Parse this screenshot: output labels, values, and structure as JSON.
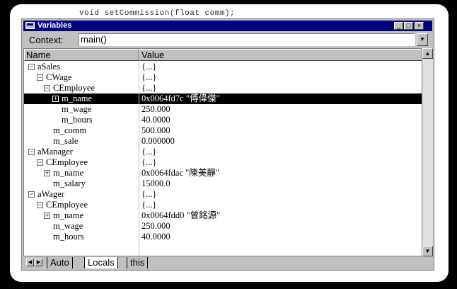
{
  "background_code": "void setCommission(float comm);",
  "window": {
    "title": "Variables"
  },
  "context": {
    "label": "Context:",
    "value": "main()"
  },
  "columns": {
    "name": "Name",
    "value": "Value"
  },
  "rows": [
    {
      "name": "aSales",
      "value": "{...}",
      "toggle": "−",
      "depth": 0
    },
    {
      "name": "CWage",
      "value": "{...}",
      "toggle": "−",
      "depth": 1
    },
    {
      "name": "CEmployee",
      "value": "{...}",
      "toggle": "−",
      "depth": 2
    },
    {
      "name": "m_name",
      "value": "0x0064fd7c \"傅偉傑\"",
      "toggle": "+",
      "depth": 3,
      "selected": true
    },
    {
      "name": "m_wage",
      "value": "250.000",
      "toggle": "",
      "depth": 3
    },
    {
      "name": "m_hours",
      "value": "40.0000",
      "toggle": "",
      "depth": 3
    },
    {
      "name": "m_comm",
      "value": "500.000",
      "toggle": "",
      "depth": 2
    },
    {
      "name": "m_sale",
      "value": "0.000000",
      "toggle": "",
      "depth": 2
    },
    {
      "name": "aManager",
      "value": "{...}",
      "toggle": "−",
      "depth": 0
    },
    {
      "name": "CEmployee",
      "value": "{...}",
      "toggle": "−",
      "depth": 1
    },
    {
      "name": "m_name",
      "value": "0x0064fdac \"陳美靜\"",
      "toggle": "+",
      "depth": 2
    },
    {
      "name": "m_salary",
      "value": "15000.0",
      "toggle": "",
      "depth": 2
    },
    {
      "name": "aWager",
      "value": "{...}",
      "toggle": "−",
      "depth": 0
    },
    {
      "name": "CEmployee",
      "value": "{...}",
      "toggle": "−",
      "depth": 1
    },
    {
      "name": "m_name",
      "value": "0x0064fdd0 \"曾銘源\"",
      "toggle": "+",
      "depth": 2
    },
    {
      "name": "m_wage",
      "value": "250.000",
      "toggle": "",
      "depth": 2
    },
    {
      "name": "m_hours",
      "value": "40.0000",
      "toggle": "",
      "depth": 2
    }
  ],
  "tabs": [
    {
      "label": "Auto"
    },
    {
      "label": "Locals",
      "active": true
    },
    {
      "label": "this"
    }
  ],
  "icons": {
    "window": "window-icon",
    "minimize": "minimize-icon",
    "maximize": "maximize-icon",
    "close": "close-icon"
  }
}
